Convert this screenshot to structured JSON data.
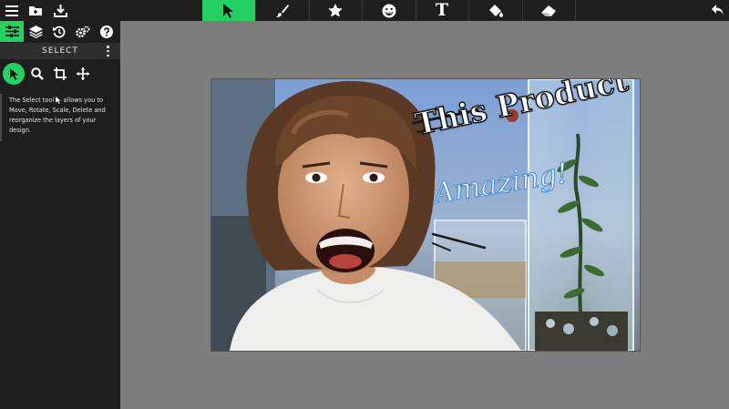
{
  "colors": {
    "accent": "#23d160",
    "toolbar_bg": "#1e1e1e",
    "workspace_bg": "#7d7d7d",
    "panel_bg": "#1e1e1e"
  },
  "top_toolbar": {
    "left_icons": [
      "menu-icon",
      "open-folder-icon",
      "download-icon"
    ],
    "tools": [
      {
        "icon": "pointer-icon",
        "active": true
      },
      {
        "icon": "brush-icon",
        "active": false
      },
      {
        "icon": "star-icon",
        "active": false
      },
      {
        "icon": "emoji-icon",
        "active": false
      },
      {
        "icon": "text-icon",
        "label": "T",
        "active": false
      },
      {
        "icon": "paint-bucket-icon",
        "active": false
      },
      {
        "icon": "eraser-icon",
        "active": false
      }
    ],
    "right_icons": [
      "undo-icon"
    ]
  },
  "side_panel": {
    "tabs": [
      {
        "icon": "sliders-icon",
        "active": true
      },
      {
        "icon": "layers-icon",
        "active": false
      },
      {
        "icon": "history-icon",
        "active": false
      },
      {
        "icon": "settings-icon",
        "active": false
      },
      {
        "icon": "help-icon",
        "active": false
      }
    ],
    "title": "SELECT",
    "subtools": [
      {
        "icon": "pointer-icon",
        "active": true
      },
      {
        "icon": "zoom-icon",
        "active": false
      },
      {
        "icon": "crop-icon",
        "active": false
      },
      {
        "icon": "move-icon",
        "active": false
      }
    ],
    "help_text_before": "The Select tool",
    "help_text_after": "allows you to Move, Rotate, Scale, Delete and reorganize the layers of your design."
  },
  "canvas": {
    "text_line_1": "This Product",
    "text_line_2": "Amazing!"
  }
}
